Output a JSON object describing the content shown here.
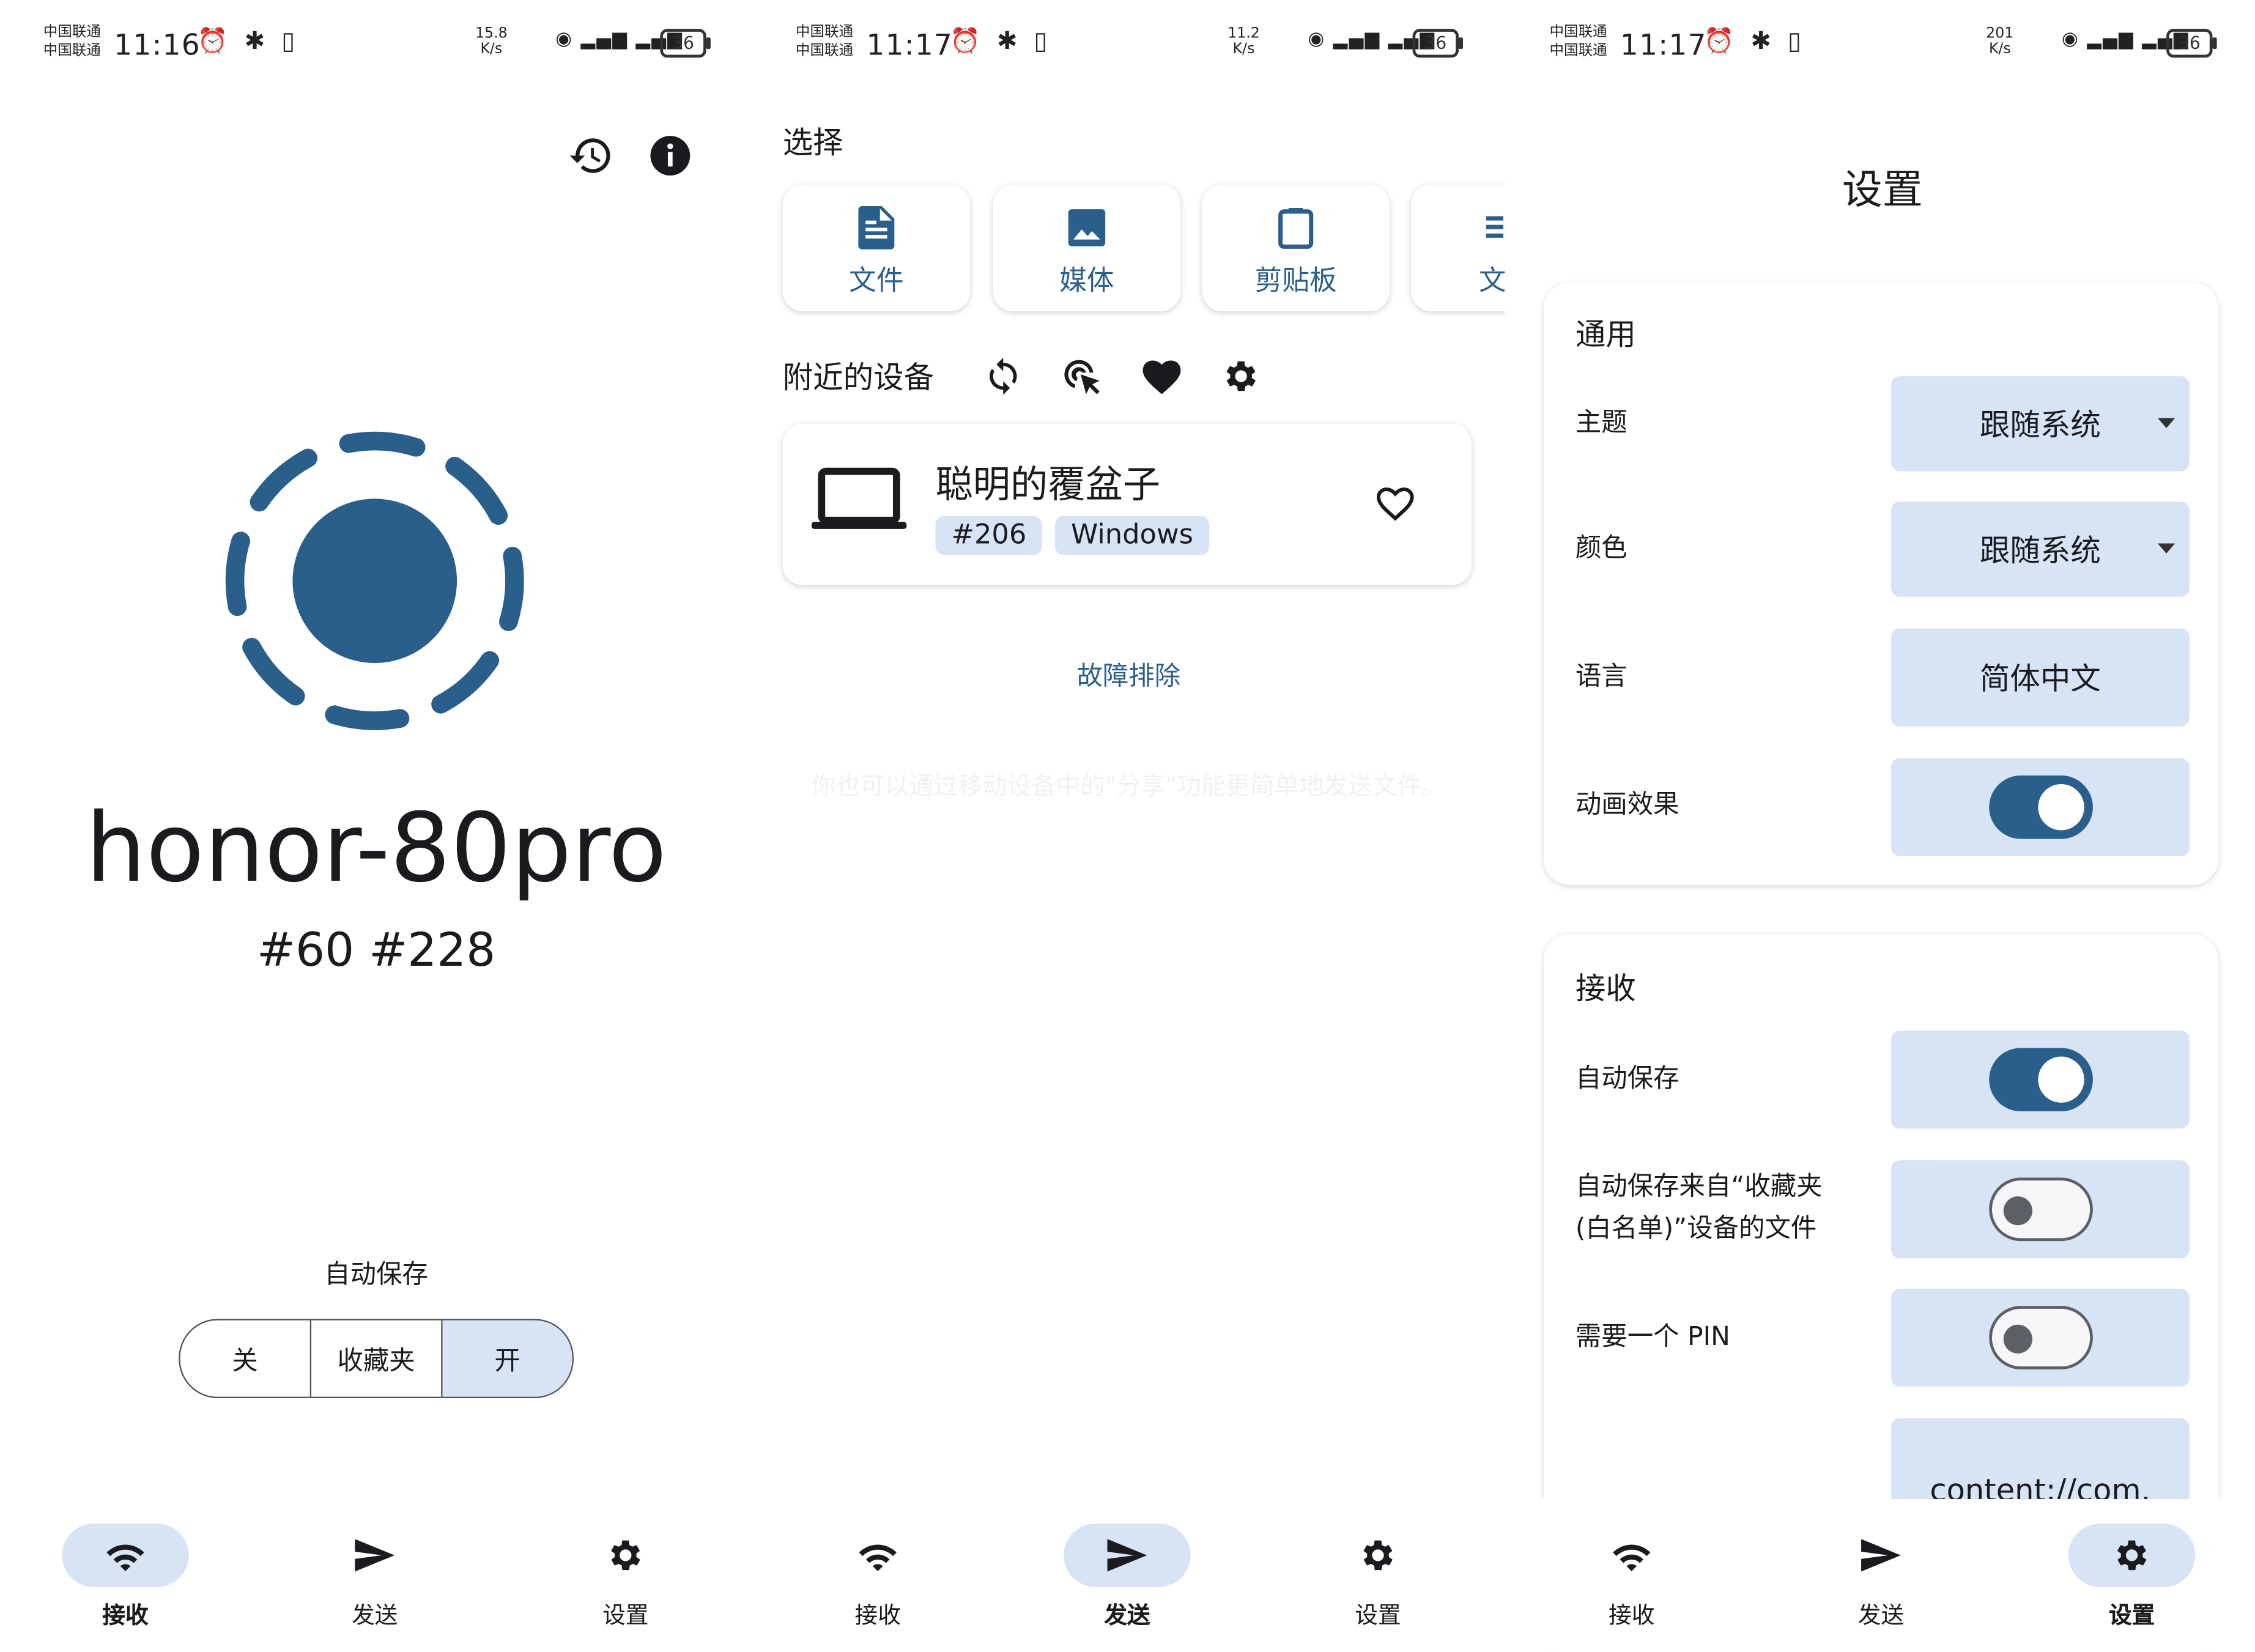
{
  "colors": {
    "accent": "#2b5f8b",
    "accent_light": "#d6e4f5"
  },
  "panels": [
    {
      "status": {
        "carrier1": "中国联通",
        "carrier2": "中国联通",
        "time": "11:16",
        "speed_val": "15.8",
        "speed_unit": "K/s",
        "battery": "36"
      },
      "device_name": "honor-80pro",
      "device_ids": "#60 #228",
      "autosave_label": "自动保存",
      "autosave_options": [
        "关",
        "收藏夹",
        "开"
      ],
      "autosave_selected": "开"
    },
    {
      "status": {
        "carrier1": "中国联通",
        "carrier2": "中国联通",
        "time": "11:17",
        "speed_val": "11.2",
        "speed_unit": "K/s",
        "battery": "36"
      },
      "select_title": "选择",
      "select_cards": [
        "文件",
        "媒体",
        "剪贴板",
        "文"
      ],
      "nearby_title": "附近的设备",
      "device": {
        "name": "聪明的覆盆子",
        "id": "#206",
        "os": "Windows"
      },
      "troubleshoot": "故障排除",
      "hint": "你也可以通过移动设备中的\"分享\"功能更简单地发送文件。"
    },
    {
      "status": {
        "carrier1": "中国联通",
        "carrier2": "中国联通",
        "time": "11:17",
        "speed_val": "201",
        "speed_unit": "K/s",
        "battery": "36"
      },
      "title": "设置",
      "general": {
        "title": "通用",
        "theme_label": "主题",
        "theme_value": "跟随系统",
        "color_label": "颜色",
        "color_value": "跟随系统",
        "language_label": "语言",
        "language_value": "简体中文",
        "animation_label": "动画效果",
        "animation_on": true
      },
      "receive": {
        "title": "接收",
        "autosave_label": "自动保存",
        "autosave_on": true,
        "favorites_label_1": "自动保存来自“收藏夹",
        "favorites_label_2": "(白名单)”设备的文件",
        "favorites_on": false,
        "pin_label": "需要一个 PIN",
        "pin_on": false,
        "destination_value": "content://com."
      }
    }
  ],
  "nav": {
    "receive": "接收",
    "send": "发送",
    "settings": "设置"
  }
}
